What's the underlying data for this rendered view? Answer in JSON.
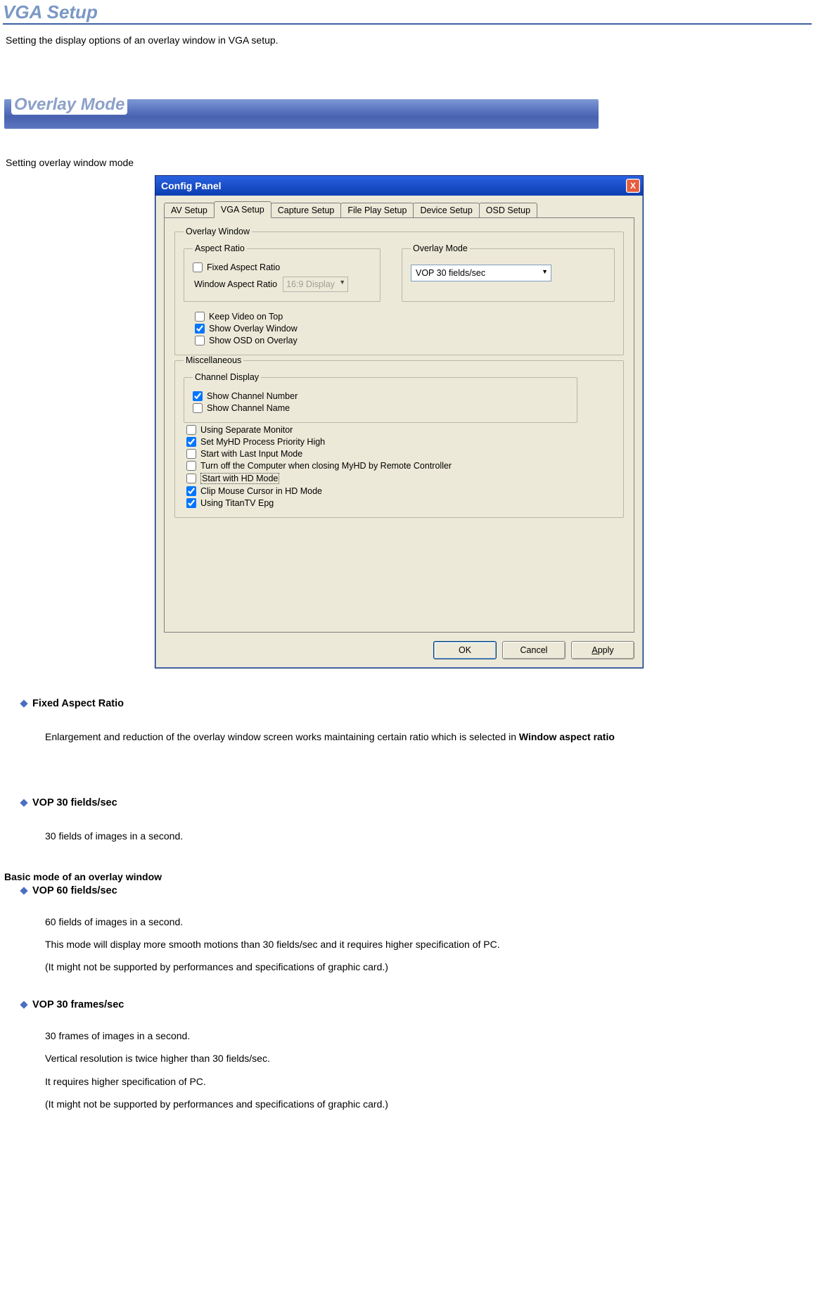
{
  "page": {
    "title": "VGA Setup",
    "intro": "Setting the display options of an overlay window in VGA setup.",
    "section_bar": "Overlay Mode",
    "sub_text": "Setting overlay window mode"
  },
  "dialog": {
    "title": "Config Panel",
    "close_x": "X",
    "tabs": [
      "AV Setup",
      "VGA Setup",
      "Capture Setup",
      "File Play Setup",
      "Device Setup",
      "OSD Setup"
    ],
    "active_tab_index": 1,
    "overlay_window": {
      "legend": "Overlay Window",
      "aspect": {
        "legend": "Aspect Ratio",
        "fixed_label": "Fixed Aspect Ratio",
        "fixed_checked": false,
        "win_aspect_label": "Window Aspect Ratio",
        "win_aspect_value": "16:9 Display",
        "win_aspect_disabled": true
      },
      "overlay_mode": {
        "legend": "Overlay Mode",
        "value": "VOP 30 fields/sec"
      },
      "keep_video_on_top": {
        "label": "Keep Video on Top",
        "checked": false
      },
      "show_overlay_window": {
        "label": "Show Overlay Window",
        "checked": true
      },
      "show_osd_on_overlay": {
        "label": "Show OSD on Overlay",
        "checked": false
      }
    },
    "misc": {
      "legend": "Miscellaneous",
      "channel": {
        "legend": "Channel Display",
        "show_number": {
          "label": "Show Channel Number",
          "checked": true
        },
        "show_name": {
          "label": "Show Channel Name",
          "checked": false
        }
      },
      "items": [
        {
          "label": "Using Separate Monitor",
          "checked": false
        },
        {
          "label": "Set MyHD Process Priority High",
          "checked": true
        },
        {
          "label": "Start with Last Input Mode",
          "checked": false
        },
        {
          "label": "Turn off the Computer when closing MyHD by Remote Controller",
          "checked": false
        },
        {
          "label": "Start with HD Mode",
          "checked": false,
          "focused": true
        },
        {
          "label": "Clip Mouse Cursor in HD Mode",
          "checked": true
        },
        {
          "label": "Using TitanTV Epg",
          "checked": true
        }
      ]
    },
    "buttons": {
      "ok": "OK",
      "cancel": "Cancel",
      "apply": "Apply"
    }
  },
  "doc": {
    "fixed_aspect": {
      "title": "Fixed Aspect Ratio",
      "body_pre": "Enlargement and reduction of the overlay window screen works maintaining certain ratio which is selected in ",
      "body_strong": "Window aspect ratio"
    },
    "vop30fields": {
      "title": "VOP 30 fields/sec",
      "body": "30 fields of images in a second."
    },
    "basic_mode": "Basic mode of an overlay window",
    "vop60fields": {
      "title": "VOP 60 fields/sec",
      "lines": [
        "60 fields of images in a second.",
        "This mode will display more smooth motions than 30 fields/sec and it requires higher specification of PC.",
        "(It might not be supported by performances and specifications of graphic card.)"
      ]
    },
    "vop30frames": {
      "title": "VOP 30 frames/sec",
      "lines": [
        "30 frames of images in a second.",
        "Vertical resolution is twice higher than 30 fields/sec.",
        "It requires higher specification of PC.",
        "(It might not be supported by performances and specifications of graphic card.)"
      ]
    }
  }
}
